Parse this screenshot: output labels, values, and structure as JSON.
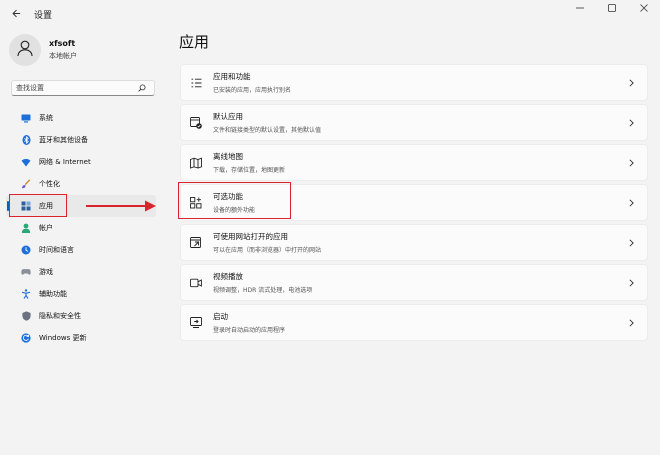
{
  "window": {
    "title": "设置",
    "back_icon": "back-arrow-icon",
    "controls": [
      "minimize-icon",
      "maximize-icon",
      "close-icon"
    ]
  },
  "profile": {
    "name": "xfsoft",
    "account_type": "本地帐户"
  },
  "search": {
    "placeholder": "查找设置"
  },
  "sidebar": {
    "items": [
      {
        "label": "系统",
        "icon": "system-icon",
        "selected": false
      },
      {
        "label": "蓝牙和其他设备",
        "icon": "bluetooth-icon",
        "selected": false
      },
      {
        "label": "网络 & Internet",
        "icon": "network-icon",
        "selected": false
      },
      {
        "label": "个性化",
        "icon": "brush-icon",
        "selected": false
      },
      {
        "label": "应用",
        "icon": "apps-icon",
        "selected": true
      },
      {
        "label": "帐户",
        "icon": "account-icon",
        "selected": false
      },
      {
        "label": "时间和语言",
        "icon": "time-language-icon",
        "selected": false
      },
      {
        "label": "游戏",
        "icon": "gaming-icon",
        "selected": false
      },
      {
        "label": "辅助功能",
        "icon": "accessibility-icon",
        "selected": false
      },
      {
        "label": "隐私和安全性",
        "icon": "shield-icon",
        "selected": false
      },
      {
        "label": "Windows 更新",
        "icon": "windows-update-icon",
        "selected": false
      }
    ]
  },
  "main": {
    "title": "应用",
    "cards": [
      {
        "title": "应用和功能",
        "subtitle": "已安装的应用，应用执行别名",
        "icon": "apps-features-icon"
      },
      {
        "title": "默认应用",
        "subtitle": "文件和链接类型的默认设置，其他默认值",
        "icon": "default-apps-icon"
      },
      {
        "title": "离线地图",
        "subtitle": "下载，存储位置，地图更新",
        "icon": "offline-maps-icon"
      },
      {
        "title": "可选功能",
        "subtitle": "设备的额外功能",
        "icon": "optional-features-icon"
      },
      {
        "title": "可使用网站打开的应用",
        "subtitle": "可以在应用（而非浏览器）中打开的网站",
        "icon": "apps-for-websites-icon"
      },
      {
        "title": "视频播放",
        "subtitle": "视频调整，HDR 流式处理，电池选项",
        "icon": "video-playback-icon"
      },
      {
        "title": "启动",
        "subtitle": "登录时自动启动的应用程序",
        "icon": "startup-icon"
      }
    ]
  },
  "colors": {
    "accent": "#0067c0",
    "annotation": "#d9242b",
    "background": "#f3f3f3"
  }
}
